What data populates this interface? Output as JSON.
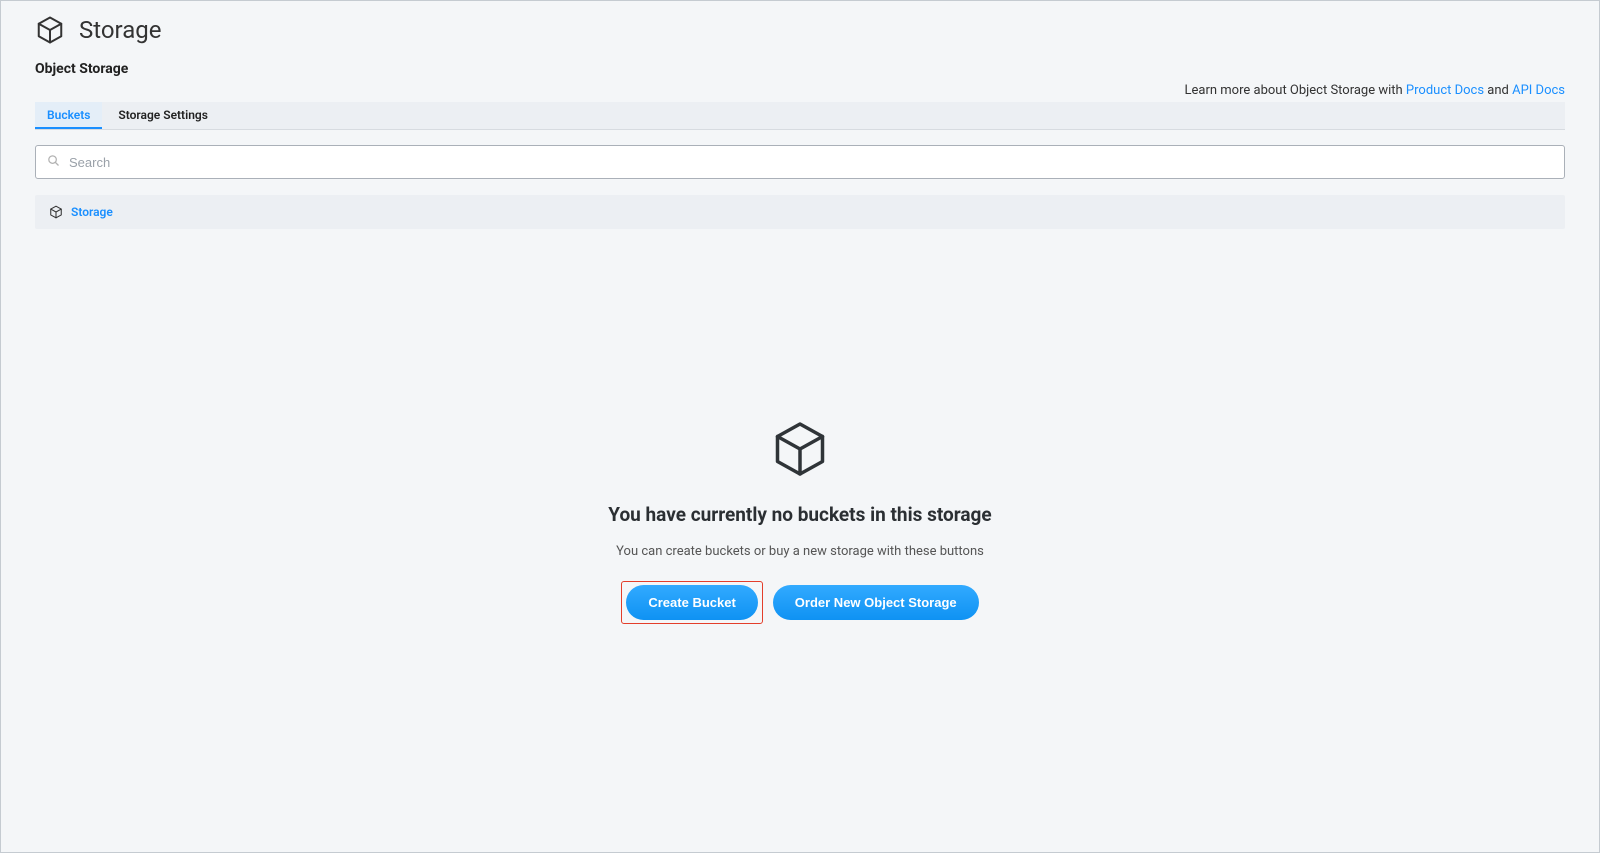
{
  "header": {
    "title": "Storage",
    "subtitle": "Object Storage"
  },
  "docs": {
    "prefix": "Learn more about Object Storage with ",
    "product_link": "Product Docs",
    "joiner": " and ",
    "api_link": "API Docs"
  },
  "tabs": {
    "buckets": "Buckets",
    "settings": "Storage Settings",
    "active": "buckets"
  },
  "search": {
    "placeholder": "Search",
    "value": ""
  },
  "breadcrumb": {
    "root": "Storage"
  },
  "empty": {
    "title": "You have currently no buckets in this storage",
    "subtitle": "You can create buckets or buy a new storage with these buttons",
    "create_label": "Create Bucket",
    "order_label": "Order New Object Storage"
  }
}
